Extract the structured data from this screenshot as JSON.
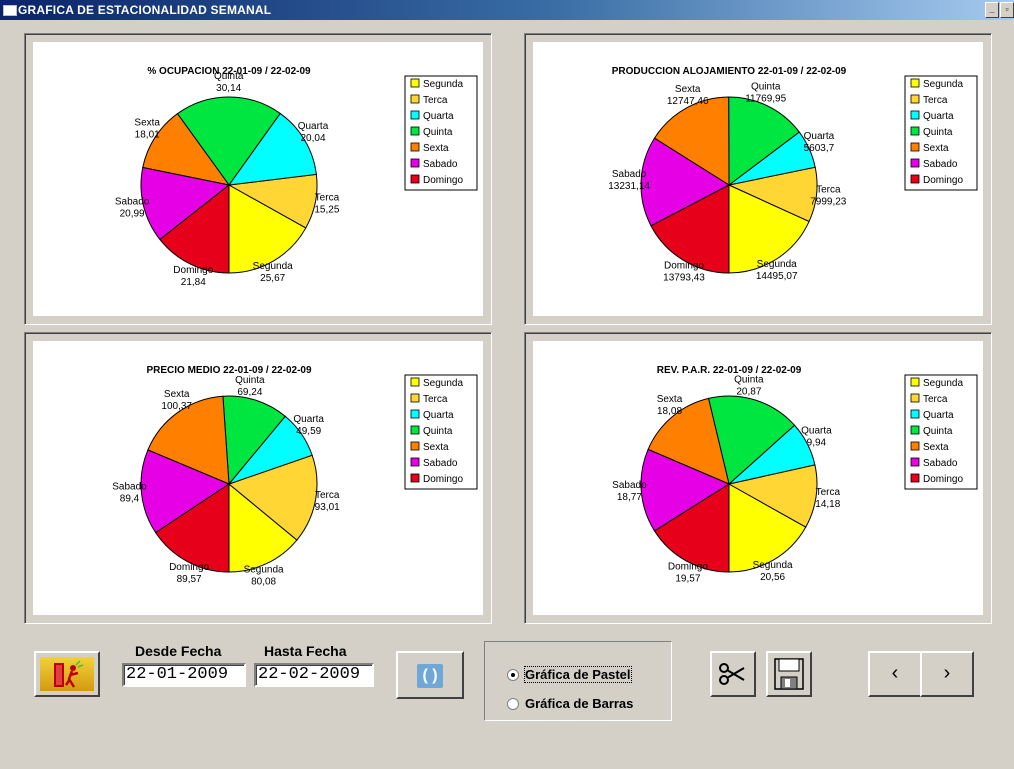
{
  "window": {
    "title": "GRAFICA DE ESTACIONALIDAD SEMANAL"
  },
  "legend_items": [
    {
      "label": "Segunda",
      "color": "#ffff00"
    },
    {
      "label": "Terca",
      "color": "#ffd633"
    },
    {
      "label": "Quarta",
      "color": "#00ffff"
    },
    {
      "label": "Quinta",
      "color": "#00e640"
    },
    {
      "label": "Sexta",
      "color": "#ff8000"
    },
    {
      "label": "Sabado",
      "color": "#e600e6"
    },
    {
      "label": "Domingo",
      "color": "#e6001a"
    }
  ],
  "chart_data": [
    {
      "type": "pie",
      "title": "% OCUPACION  22-01-09 / 22-02-09",
      "categories": [
        "Segunda",
        "Terca",
        "Quarta",
        "Quinta",
        "Sexta",
        "Sabado",
        "Domingo"
      ],
      "values": [
        25.67,
        15.25,
        20.04,
        30.14,
        18.01,
        20.99,
        21.84
      ],
      "value_labels": [
        "25,67",
        "15,25",
        "20,04",
        "30,14",
        "18,01",
        "20,99",
        "21,84"
      ],
      "legend": "top-right"
    },
    {
      "type": "pie",
      "title": "PRODUCCION ALOJAMIENTO 22-01-09 / 22-02-09",
      "categories": [
        "Segunda",
        "Terca",
        "Quarta",
        "Quinta",
        "Sexta",
        "Sabado",
        "Domingo"
      ],
      "values": [
        14495.07,
        7999.23,
        5603.7,
        11769.95,
        12747.46,
        13231.14,
        13793.43
      ],
      "value_labels": [
        "14495,07",
        "7999,23",
        "5603,7",
        "11769,95",
        "12747,46",
        "13231,14",
        "13793,43"
      ],
      "legend": "top-right"
    },
    {
      "type": "pie",
      "title": "PRECIO MEDIO 22-01-09 / 22-02-09",
      "categories": [
        "Segunda",
        "Terca",
        "Quarta",
        "Quinta",
        "Sexta",
        "Sabado",
        "Domingo"
      ],
      "values": [
        80.08,
        93.01,
        49.59,
        69.24,
        100.37,
        89.4,
        89.57
      ],
      "value_labels": [
        "80,08",
        "93,01",
        "49,59",
        "69,24",
        "100,37",
        "89,4",
        "89,57"
      ],
      "legend": "top-right"
    },
    {
      "type": "pie",
      "title": "REV. P.A.R.  22-01-09 / 22-02-09",
      "categories": [
        "Segunda",
        "Terca",
        "Quarta",
        "Quinta",
        "Sexta",
        "Sabado",
        "Domingo"
      ],
      "values": [
        20.56,
        14.18,
        9.94,
        20.87,
        18.08,
        18.77,
        19.57
      ],
      "value_labels": [
        "20,56",
        "14,18",
        "9,94",
        "20,87",
        "18,08",
        "18,77",
        "19,57"
      ],
      "legend": "top-right"
    }
  ],
  "filters": {
    "desde_label": "Desde Fecha",
    "desde_value": "22-01-2009",
    "hasta_label": "Hasta Fecha",
    "hasta_value": "22-02-2009"
  },
  "chart_type": {
    "pastel_label": "Gráfica de Pastel",
    "barras_label": "Gráfica de Barras",
    "selected": "pastel"
  },
  "nav": {
    "prev": "‹",
    "next": "›"
  }
}
